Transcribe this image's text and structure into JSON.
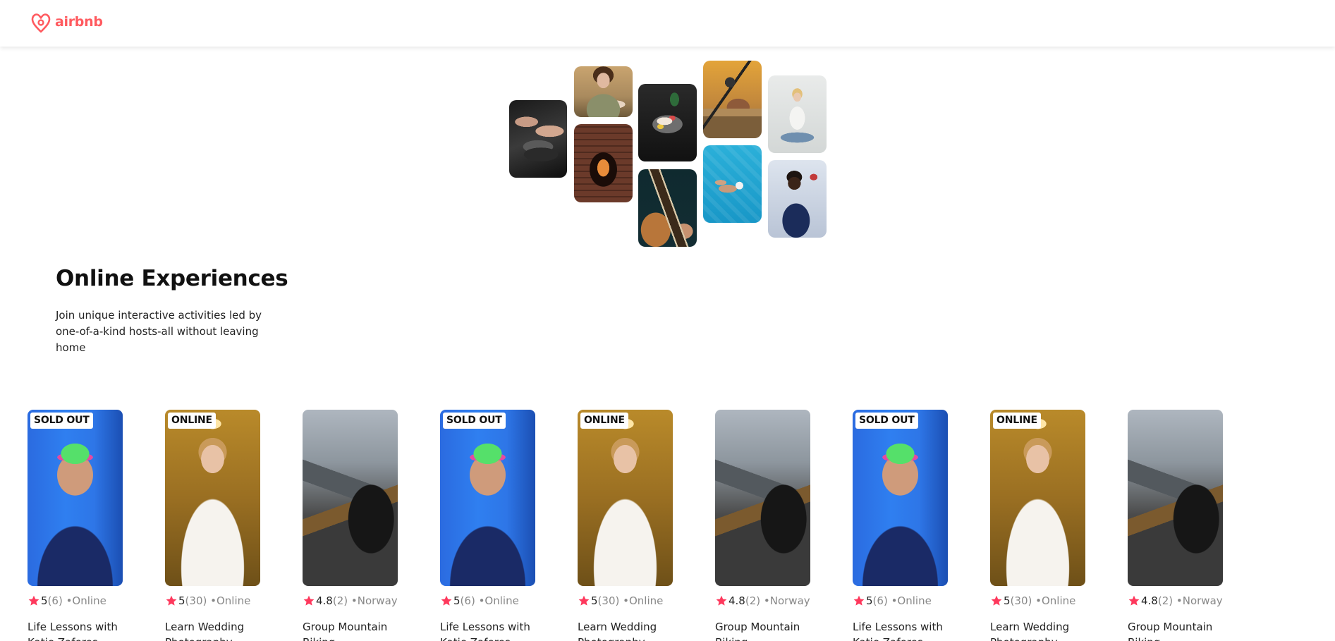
{
  "header": {
    "brand": "airbnb",
    "brand_color": "#FF5A5F",
    "logo_icon": "airbnb-belo-icon"
  },
  "hero": {
    "images": [
      {
        "name": "pan-cooking-photo"
      },
      {
        "name": "woman-portrait-photo"
      },
      {
        "name": "fireplace-performer-photo"
      },
      {
        "name": "food-bowl-photo"
      },
      {
        "name": "guitar-photo"
      },
      {
        "name": "microphone-photo"
      },
      {
        "name": "swimmer-photo"
      },
      {
        "name": "yoga-photo"
      },
      {
        "name": "singer-photo"
      }
    ]
  },
  "intro": {
    "title": "Online Experiences",
    "text": "Join unique interactive activities led by one-of-a-kind hosts-all without leaving home"
  },
  "colors": {
    "star": "#FE385C",
    "muted": "#888888",
    "text": "#222222"
  },
  "cards": [
    {
      "badge": "SOLD OUT",
      "image": "swimmer",
      "rating": "5",
      "reviews": "(6)",
      "location": "•Online",
      "title": "Life Lessons with Katie Zaferes"
    },
    {
      "badge": "ONLINE",
      "image": "bride",
      "rating": "5",
      "reviews": "(30)",
      "location": "•Online",
      "title": "Learn Wedding Photography"
    },
    {
      "badge": "",
      "image": "bike",
      "rating": "4.8",
      "reviews": "(2)",
      "location": "•Norway",
      "title": "Group Mountain Biking"
    },
    {
      "badge": "SOLD OUT",
      "image": "swimmer",
      "rating": "5",
      "reviews": "(6)",
      "location": "•Online",
      "title": "Life Lessons with Katie Zaferes"
    },
    {
      "badge": "ONLINE",
      "image": "bride",
      "rating": "5",
      "reviews": "(30)",
      "location": "•Online",
      "title": "Learn Wedding Photography"
    },
    {
      "badge": "",
      "image": "bike",
      "rating": "4.8",
      "reviews": "(2)",
      "location": "•Norway",
      "title": "Group Mountain Biking"
    },
    {
      "badge": "SOLD OUT",
      "image": "swimmer",
      "rating": "5",
      "reviews": "(6)",
      "location": "•Online",
      "title": "Life Lessons with Katie Zaferes"
    },
    {
      "badge": "ONLINE",
      "image": "bride",
      "rating": "5",
      "reviews": "(30)",
      "location": "•Online",
      "title": "Learn Wedding Photography"
    },
    {
      "badge": "",
      "image": "bike",
      "rating": "4.8",
      "reviews": "(2)",
      "location": "•Norway",
      "title": "Group Mountain Biking"
    }
  ]
}
